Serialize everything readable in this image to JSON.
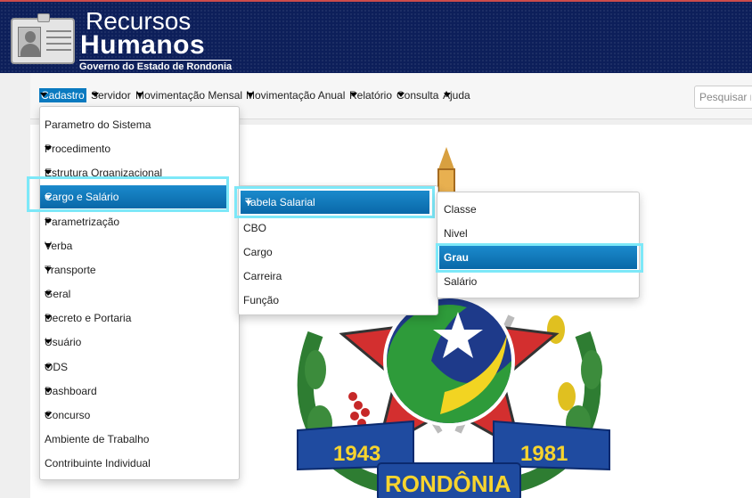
{
  "brand": {
    "title_line1": "Recursos",
    "title_line2": "Humanos",
    "subtitle": "Governo do Estado de Rondonia"
  },
  "nav": {
    "items": [
      {
        "label": "Cadastro"
      },
      {
        "label": "Servidor"
      },
      {
        "label": "Movimentação Mensal"
      },
      {
        "label": "Movimentação Anual"
      },
      {
        "label": "Relatório"
      },
      {
        "label": "Consulta"
      },
      {
        "label": "Ajuda"
      }
    ],
    "search_placeholder": "Pesquisar n"
  },
  "cadastro_menu": {
    "items": [
      {
        "label": "Parametro do Sistema"
      },
      {
        "label": "Procedimento"
      },
      {
        "label": "Estrutura Organizacional"
      },
      {
        "label": "Cargo e Salário"
      },
      {
        "label": "Parametrização"
      },
      {
        "label": "Verba"
      },
      {
        "label": "Transporte"
      },
      {
        "label": "Geral"
      },
      {
        "label": "Decreto e Portaria"
      },
      {
        "label": "Usuário"
      },
      {
        "label": "ODS"
      },
      {
        "label": "Dashboard"
      },
      {
        "label": "Concurso"
      },
      {
        "label": "Ambiente de Trabalho"
      },
      {
        "label": "Contribuinte Individual"
      }
    ]
  },
  "cargo_menu": {
    "items": [
      {
        "label": "Tabela Salarial"
      },
      {
        "label": "CBO"
      },
      {
        "label": "Cargo"
      },
      {
        "label": "Carreira"
      },
      {
        "label": "Função"
      }
    ]
  },
  "tabela_menu": {
    "items": [
      {
        "label": "Classe"
      },
      {
        "label": "Nivel"
      },
      {
        "label": "Grau"
      },
      {
        "label": "Salário"
      }
    ]
  },
  "crest": {
    "year_left": "1943",
    "year_right": "1981",
    "name": "RONDÔNIA"
  },
  "colors": {
    "header_bg": "#0d1f5a",
    "menu_active": "#0a7ac0",
    "highlight": "#7de8f8"
  }
}
